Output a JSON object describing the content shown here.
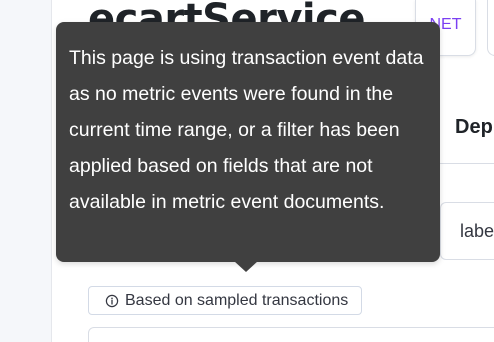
{
  "header": {
    "page_title": "ecartService",
    "agent_badge": "NET"
  },
  "section": {
    "title": "Dep"
  },
  "filter": {
    "field_label": "labe"
  },
  "sampled_badge": {
    "icon": "info-icon",
    "label": "Based on sampled transactions"
  },
  "tooltip": {
    "text": "This page is using transaction event data as no metric events were found in the current time range, or a filter has been applied based on fields that are not available in metric event documents."
  },
  "colors": {
    "tooltip_bg": "#404040",
    "agent_accent": "#7b3ff2",
    "text_dark": "#1f2328"
  }
}
